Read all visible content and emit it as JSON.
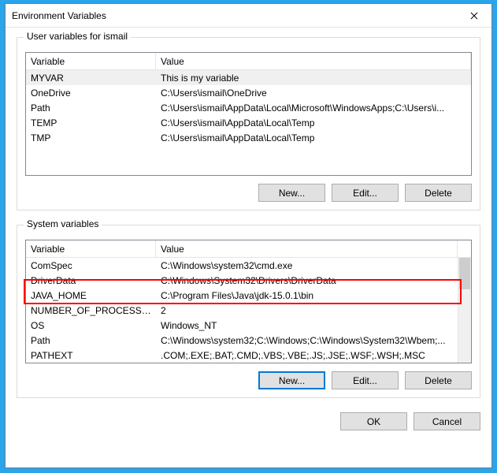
{
  "window": {
    "title": "Environment Variables"
  },
  "user_section": {
    "legend": "User variables for ismail",
    "headers": {
      "variable": "Variable",
      "value": "Value"
    },
    "rows": [
      {
        "var": "MYVAR",
        "val": "This is my variable"
      },
      {
        "var": "OneDrive",
        "val": "C:\\Users\\ismail\\OneDrive"
      },
      {
        "var": "Path",
        "val": "C:\\Users\\ismail\\AppData\\Local\\Microsoft\\WindowsApps;C:\\Users\\i..."
      },
      {
        "var": "TEMP",
        "val": "C:\\Users\\ismail\\AppData\\Local\\Temp"
      },
      {
        "var": "TMP",
        "val": "C:\\Users\\ismail\\AppData\\Local\\Temp"
      }
    ],
    "buttons": {
      "new": "New...",
      "edit": "Edit...",
      "delete": "Delete"
    }
  },
  "system_section": {
    "legend": "System variables",
    "headers": {
      "variable": "Variable",
      "value": "Value"
    },
    "rows": [
      {
        "var": "ComSpec",
        "val": "C:\\Windows\\system32\\cmd.exe"
      },
      {
        "var": "DriverData",
        "val": "C:\\Windows\\System32\\Drivers\\DriverData"
      },
      {
        "var": "JAVA_HOME",
        "val": "C:\\Program Files\\Java\\jdk-15.0.1\\bin"
      },
      {
        "var": "NUMBER_OF_PROCESSORS",
        "val": "2"
      },
      {
        "var": "OS",
        "val": "Windows_NT"
      },
      {
        "var": "Path",
        "val": "C:\\Windows\\system32;C:\\Windows;C:\\Windows\\System32\\Wbem;..."
      },
      {
        "var": "PATHEXT",
        "val": ".COM;.EXE;.BAT;.CMD;.VBS;.VBE;.JS;.JSE;.WSF;.WSH;.MSC"
      }
    ],
    "buttons": {
      "new": "New...",
      "edit": "Edit...",
      "delete": "Delete"
    }
  },
  "dialog_buttons": {
    "ok": "OK",
    "cancel": "Cancel"
  }
}
